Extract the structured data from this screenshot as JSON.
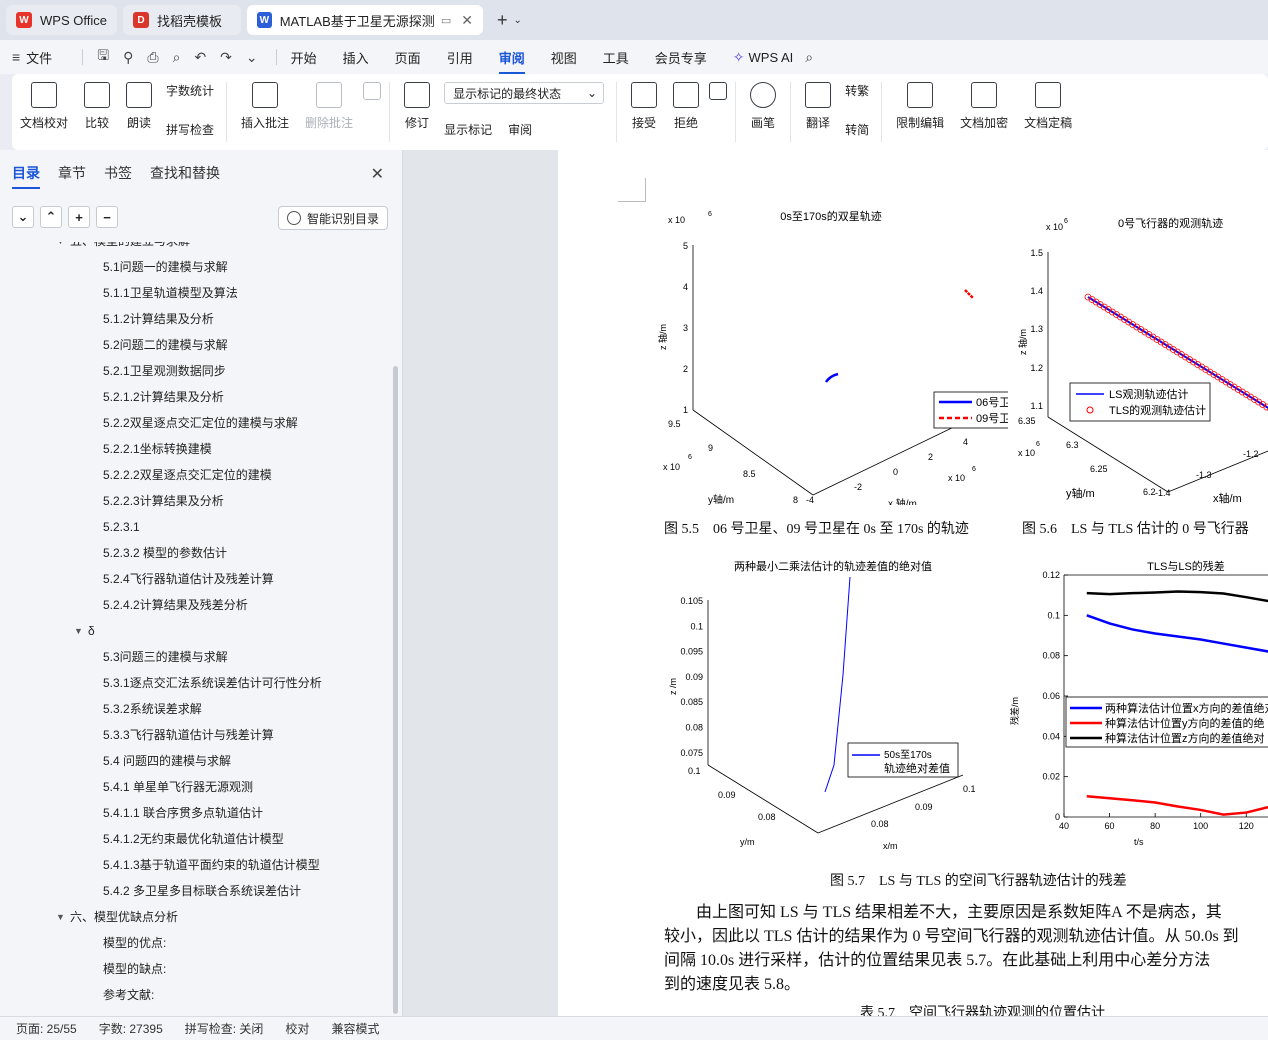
{
  "tabs": [
    {
      "label": "WPS Office",
      "icon": "wps-logo-icon",
      "color": "#e8332b"
    },
    {
      "label": "找稻壳模板",
      "icon": "docer-logo-icon",
      "color": "#d9372c"
    },
    {
      "label": "MATLAB基于卫星无源探测的",
      "icon": "word-doc-icon",
      "color": "#2b5fd9"
    }
  ],
  "menu": {
    "file": "文件",
    "items": [
      "开始",
      "插入",
      "页面",
      "引用",
      "审阅",
      "视图",
      "工具",
      "会员专享"
    ],
    "active": "审阅",
    "wps_ai": "WPS AI"
  },
  "ribbon": {
    "proofread": "文档校对",
    "compare": "比较",
    "read_aloud": "朗读",
    "word_count": "字数统计",
    "spell_check": "拼写检查",
    "insert_comment": "插入批注",
    "delete_comment": "删除批注",
    "revise": "修订",
    "markup_dropdown": "显示标记的最终状态",
    "show_markup": "显示标记",
    "review_pane": "审阅",
    "accept": "接受",
    "reject": "拒绝",
    "pen": "画笔",
    "translate": "翻译",
    "to_traditional": "转繁",
    "to_simplified": "转简",
    "restrict_edit": "限制编辑",
    "encrypt": "文档加密",
    "finalize": "文档定稿"
  },
  "panel": {
    "tabs": [
      "目录",
      "章节",
      "书签",
      "查找和替换"
    ],
    "smart_toc": "智能识别目录",
    "toc": [
      {
        "text": "五、模型的建立与求解",
        "level": 1,
        "tri": true
      },
      {
        "text": "5.1问题一的建模与求解",
        "level": 2
      },
      {
        "text": "5.1.1卫星轨道模型及算法",
        "level": 2
      },
      {
        "text": "5.1.2计算结果及分析",
        "level": 2
      },
      {
        "text": "5.2问题二的建模与求解",
        "level": 2
      },
      {
        "text": "5.2.1卫星观测数据同步",
        "level": 2
      },
      {
        "text": "5.2.1.2计算结果及分析",
        "level": 2
      },
      {
        "text": "5.2.2双星逐点交汇定位的建模与求解",
        "level": 2
      },
      {
        "text": "5.2.2.1坐标转换建模",
        "level": 2
      },
      {
        "text": "5.2.2.2双星逐点交汇定位的建模",
        "level": 2
      },
      {
        "text": "5.2.2.3计算结果及分析",
        "level": 2
      },
      {
        "text": "5.2.3.1",
        "level": 2
      },
      {
        "text": "5.2.3.2 模型的参数估计",
        "level": 2
      },
      {
        "text": "5.2.4飞行器轨道估计及残差计算",
        "level": 2
      },
      {
        "text": "5.2.4.2计算结果及残差分析",
        "level": 2
      },
      {
        "text": "δ",
        "level": 1.5,
        "tri": true
      },
      {
        "text": "5.3问题三的建模与求解",
        "level": 2
      },
      {
        "text": "5.3.1逐点交汇法系统误差估计可行性分析",
        "level": 2
      },
      {
        "text": "5.3.2系统误差求解",
        "level": 2
      },
      {
        "text": "5.3.3飞行器轨道估计与残差计算",
        "level": 2
      },
      {
        "text": "5.4 问题四的建模与求解",
        "level": 2
      },
      {
        "text": "5.4.1 单星单飞行器无源观测",
        "level": 2
      },
      {
        "text": "5.4.1.1 联合序贯多点轨道估计",
        "level": 2
      },
      {
        "text": "5.4.1.2无约束最优化轨道估计模型",
        "level": 2
      },
      {
        "text": "5.4.1.3基于轨道平面约束的轨道估计模型",
        "level": 2
      },
      {
        "text": "5.4.2 多卫星多目标联合系统误差估计",
        "level": 2
      },
      {
        "text": "六、模型优缺点分析",
        "level": 1,
        "tri": true
      },
      {
        "text": "模型的优点:",
        "level": 2
      },
      {
        "text": "模型的缺点:",
        "level": 2
      },
      {
        "text": "参考文献:",
        "level": 2
      }
    ]
  },
  "doc": {
    "fig55": {
      "title": "0s至170s的双星轨迹",
      "zexp": "x 10",
      "zexp_sup": "6",
      "zlabel": "z 轴/m",
      "zticks": [
        "5",
        "4",
        "3",
        "2",
        "1"
      ],
      "yticks": [
        "9.5",
        "9",
        "8.5",
        "8"
      ],
      "yexp": "x 10",
      "yexp_sup": "6",
      "ylabel": "y轴/m",
      "xticks": [
        "-4",
        "-2",
        "0",
        "2",
        "4"
      ],
      "xexp": "x 10",
      "xexp_sup": "6",
      "xlabel": "x 轴/m",
      "legend": [
        "06号卫星",
        "09号卫星"
      ],
      "caption": "图 5.5　06 号卫星、09 号卫星在 0s 至 170s 的轨迹"
    },
    "fig56": {
      "title": "0号飞行器的观测轨迹",
      "zexp": "x 10",
      "zexp_sup": "6",
      "zlabel": "z 轴/m",
      "zticks": [
        "1.5",
        "1.4",
        "1.3",
        "1.2",
        "1.1"
      ],
      "yticks": [
        "6.35",
        "6.3",
        "6.25",
        "6.2"
      ],
      "yexp": "x 10",
      "yexp_sup": "6",
      "ylabel": "y轴/m",
      "xticks": [
        "-1.4",
        "-1.3",
        "-1.2"
      ],
      "xlabel": "x轴/m",
      "legend": [
        "LS观测轨迹估计",
        "TLS的观测轨迹估计"
      ],
      "caption": "图 5.6　LS 与 TLS 估计的 0 号飞行器"
    },
    "fig57a": {
      "title": "两种最小二乘法估计的轨迹差值的绝对值",
      "zlabel": "z /m",
      "zticks": [
        "0.105",
        "0.1",
        "0.095",
        "0.09",
        "0.085",
        "0.08",
        "0.075"
      ],
      "yticks": [
        "0.1",
        "0.09",
        "0.08"
      ],
      "ylabel": "y/m",
      "xticks": [
        "0.08",
        "0.09",
        "0.1"
      ],
      "xlabel": "x/m",
      "legend": [
        "50s至170s",
        "轨迹绝对差值"
      ]
    },
    "fig57b": {
      "title": "TLS与LS的残差",
      "ylabel": "残差/m",
      "xlabel": "t/s",
      "legend": [
        "两种算法估计位置x方向的差值绝对",
        "种算法估计位置y方向的差值的绝",
        "种算法估计位置z方向的差值绝对"
      ]
    },
    "fig57_caption": "图 5.7　LS 与 TLS 的空间飞行器轨迹估计的残差",
    "para": [
      "由上图可知 LS 与 TLS 结果相差不大，主要原因是系数矩阵A 不是病态，其",
      "较小，因此以 TLS 估计的结果作为 0 号空间飞行器的观测轨迹估计值。从 50.0s 到",
      "间隔 10.0s 进行采样，估计的位置结果见表 5.7。在此基础上利用中心差分方法",
      "到的速度见表 5.8。"
    ],
    "table_caption": "表 5.7　空间飞行器轨迹观测的位置估计"
  },
  "chart_data": [
    {
      "type": "line",
      "title": "TLS与LS的残差",
      "xlabel": "t/s",
      "ylabel": "残差/m",
      "xlim": [
        40,
        155
      ],
      "ylim": [
        0,
        0.12
      ],
      "x_ticks": [
        40,
        60,
        80,
        100,
        120,
        140
      ],
      "y_ticks": [
        0,
        0.02,
        0.04,
        0.06,
        0.08,
        0.1,
        0.12
      ],
      "x": [
        50,
        60,
        70,
        80,
        90,
        100,
        110,
        120,
        130,
        140,
        150
      ],
      "series": [
        {
          "name": "两种算法估计位置x方向的差值绝对",
          "color": "#0000ff",
          "values": [
            0.1,
            0.096,
            0.093,
            0.091,
            0.0895,
            0.088,
            0.086,
            0.084,
            0.082,
            0.0805,
            0.0785
          ]
        },
        {
          "name": "种算法估计位置y方向的差值的绝",
          "color": "#ff0000",
          "values": [
            0.0103,
            0.0093,
            0.0083,
            0.0072,
            0.0052,
            0.0035,
            0.0012,
            0.0022,
            0.005,
            0.008,
            0.011
          ]
        },
        {
          "name": "种算法估计位置z方向的差值绝对",
          "color": "#000000",
          "values": [
            0.111,
            0.1105,
            0.111,
            0.1113,
            0.1118,
            0.1115,
            0.1108,
            0.109,
            0.107,
            0.1045,
            0.101
          ]
        }
      ]
    }
  ],
  "status": {
    "page": "页面: 25/55",
    "words": "字数: 27395",
    "spell": "拼写检查: 关闭",
    "proof": "校对",
    "compat": "兼容模式"
  }
}
